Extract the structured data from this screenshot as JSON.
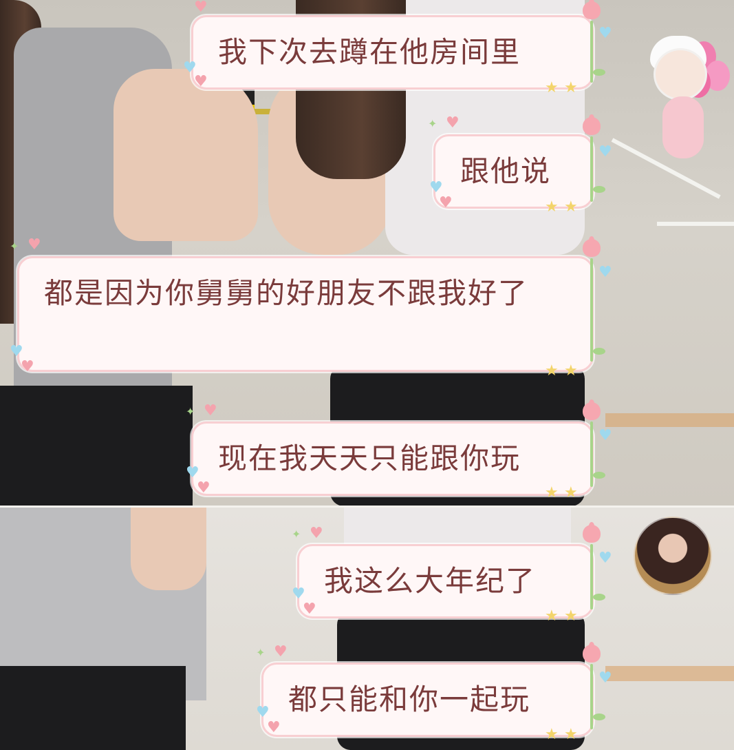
{
  "messages": [
    {
      "text": "我下次去蹲在他房间里"
    },
    {
      "text": "跟他说"
    },
    {
      "text": "都是因为你舅舅的好朋友不跟我好了"
    },
    {
      "text": "现在我天天只能跟你玩"
    },
    {
      "text": "我这么大年纪了"
    },
    {
      "text": "都只能和你一起玩"
    }
  ],
  "colors": {
    "bubble_bg": "#fff7f7",
    "bubble_border": "#f8cfd2",
    "text": "#7a3b3b",
    "tulip": "#f6a7b0",
    "stem": "#a8d48a"
  },
  "icons": {
    "sticker": "balloon-girl-sticker",
    "avatar": "user-avatar"
  }
}
